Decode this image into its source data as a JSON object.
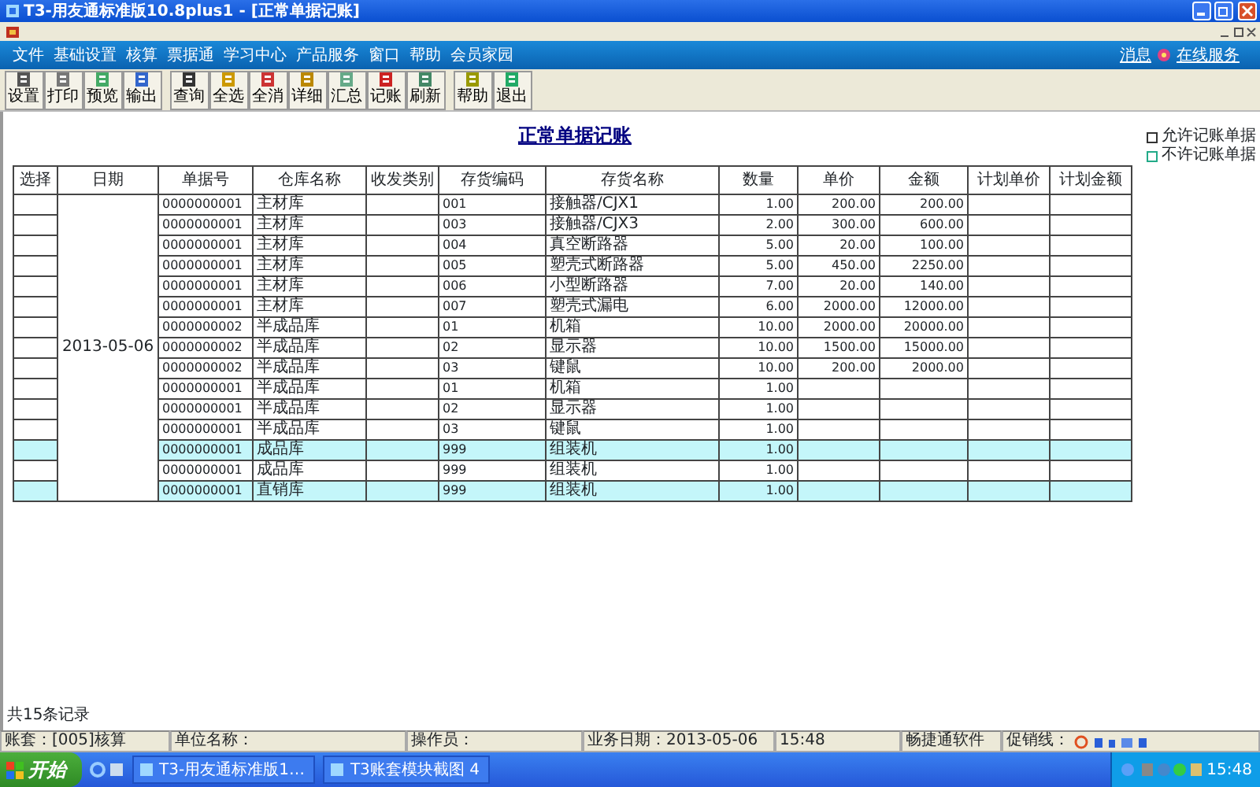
{
  "window": {
    "title": "T3-用友通标准版10.8plus1 - [正常单据记账]"
  },
  "menu": [
    "文件",
    "基础设置",
    "核算",
    "票据通",
    "学习中心",
    "产品服务",
    "窗口",
    "帮助",
    "会员家园"
  ],
  "menu_right": {
    "message": "消息",
    "online_service": "在线服务"
  },
  "toolbar": [
    [
      "设置",
      "打印",
      "预览",
      "输出"
    ],
    [
      "查询",
      "全选",
      "全消",
      "详细",
      "汇总",
      "记账",
      "刷新"
    ],
    [
      "帮助",
      "退出"
    ]
  ],
  "report": {
    "title": "正常单据记账",
    "filters": [
      {
        "label": "允许记账单据",
        "checked": false
      },
      {
        "label": "不许记账单据",
        "checked": false
      }
    ]
  },
  "table": {
    "columns": [
      "选择",
      "日期",
      "单据号",
      "仓库名称",
      "收发类别",
      "存货编码",
      "存货名称",
      "数量",
      "单价",
      "金额",
      "计划单价",
      "计划金额"
    ],
    "date": "2013-05-06",
    "rows": [
      {
        "doc_no": "0000000001",
        "warehouse": "主材库",
        "code": "001",
        "item": "接触器/CJX1",
        "quantity": "1.00",
        "unit_price": "200.00",
        "amount": "200.00",
        "highlighted": false
      },
      {
        "doc_no": "0000000001",
        "warehouse": "主材库",
        "code": "003",
        "item": "接触器/CJX3",
        "quantity": "2.00",
        "unit_price": "300.00",
        "amount": "600.00",
        "highlighted": false
      },
      {
        "doc_no": "0000000001",
        "warehouse": "主材库",
        "code": "004",
        "item": "真空断路器",
        "quantity": "5.00",
        "unit_price": "20.00",
        "amount": "100.00",
        "highlighted": false
      },
      {
        "doc_no": "0000000001",
        "warehouse": "主材库",
        "code": "005",
        "item": "塑壳式断路器",
        "quantity": "5.00",
        "unit_price": "450.00",
        "amount": "2250.00",
        "highlighted": false
      },
      {
        "doc_no": "0000000001",
        "warehouse": "主材库",
        "code": "006",
        "item": "小型断路器",
        "quantity": "7.00",
        "unit_price": "20.00",
        "amount": "140.00",
        "highlighted": false
      },
      {
        "doc_no": "0000000001",
        "warehouse": "主材库",
        "code": "007",
        "item": "塑壳式漏电",
        "quantity": "6.00",
        "unit_price": "2000.00",
        "amount": "12000.00",
        "highlighted": false
      },
      {
        "doc_no": "0000000002",
        "warehouse": "半成品库",
        "code": "01",
        "item": "机箱",
        "quantity": "10.00",
        "unit_price": "2000.00",
        "amount": "20000.00",
        "highlighted": false
      },
      {
        "doc_no": "0000000002",
        "warehouse": "半成品库",
        "code": "02",
        "item": "显示器",
        "quantity": "10.00",
        "unit_price": "1500.00",
        "amount": "15000.00",
        "highlighted": false
      },
      {
        "doc_no": "0000000002",
        "warehouse": "半成品库",
        "code": "03",
        "item": "键鼠",
        "quantity": "10.00",
        "unit_price": "200.00",
        "amount": "2000.00",
        "highlighted": false
      },
      {
        "doc_no": "0000000001",
        "warehouse": "半成品库",
        "code": "01",
        "item": "机箱",
        "quantity": "1.00",
        "highlighted": false
      },
      {
        "doc_no": "0000000001",
        "warehouse": "半成品库",
        "code": "02",
        "item": "显示器",
        "quantity": "1.00",
        "highlighted": false
      },
      {
        "doc_no": "0000000001",
        "warehouse": "半成品库",
        "code": "03",
        "item": "键鼠",
        "quantity": "1.00",
        "highlighted": false
      },
      {
        "doc_no": "0000000001",
        "warehouse": "成品库",
        "code": "999",
        "item": "组装机",
        "quantity": "1.00",
        "highlighted": true
      },
      {
        "doc_no": "0000000001",
        "warehouse": "成品库",
        "code": "999",
        "item": "组装机",
        "quantity": "1.00",
        "highlighted": false
      },
      {
        "doc_no": "0000000001",
        "warehouse": "直销库",
        "code": "999",
        "item": "组装机",
        "quantity": "1.00",
        "highlighted": true
      }
    ]
  },
  "record_count": "共15条记录",
  "status_bar": [
    "账套：[005]核算",
    "单位名称：",
    "操作员：",
    "业务日期：2013-05-06",
    "15:48",
    "畅捷通软件",
    "促销线："
  ],
  "taskbar": {
    "start": "开始",
    "tasks": [
      "T3-用友通标准版1…",
      "T3账套模块截图 4"
    ],
    "clock": "15:48"
  }
}
